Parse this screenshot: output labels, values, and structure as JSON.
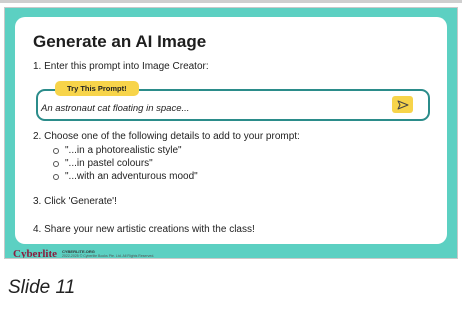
{
  "slide": {
    "title": "Generate an AI Image",
    "step1": "1. Enter this prompt into Image Creator:",
    "prompt_pill": "Try This Prompt!",
    "prompt_text": "An astronaut cat floating in space...",
    "step2": "2. Choose one of the following details to add to your prompt:",
    "options": [
      "\"...in a photorealistic style\"",
      "\"...in pastel colours\"",
      "\"...with an adventurous mood\""
    ],
    "step3": "3. Click 'Generate'!",
    "step4": "4. Share your new artistic creations with the class!"
  },
  "footer": {
    "logo": "Cyberlite",
    "site": "CYBERLITE.ORG",
    "copyright": "2022-2025 © Cyberlite Books Pte. Ltd. All Rights Reserved."
  },
  "caption": "Slide 11",
  "icons": {
    "send": "send-arrow-icon"
  },
  "colors": {
    "slide_background": "#5cd0c2",
    "accent_yellow": "#f7d44a",
    "prompt_border": "#2b8c8a",
    "logo": "#8a1d3e"
  }
}
